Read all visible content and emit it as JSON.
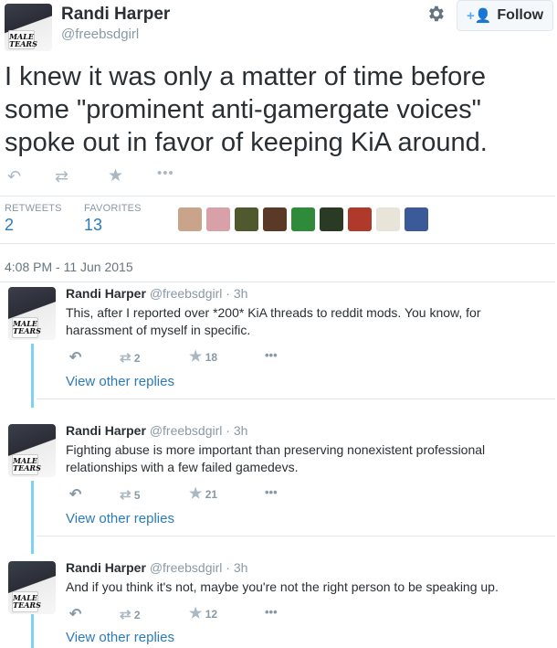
{
  "header": {
    "name": "Randi Harper",
    "handle": "@freebsdgirl",
    "follow_label": "Follow",
    "avatar_text": "MALE TEARS"
  },
  "tweet": {
    "text_lines": [
      "I knew it was only a matter of time before",
      "some \"prominent anti-gamergate voices\"",
      "spoke out in favor of keeping KiA around."
    ],
    "stats": {
      "retweets_label": "RETWEETS",
      "retweets_value": "2",
      "favorites_label": "FAVORITES",
      "favorites_value": "13"
    },
    "timestamp": "4:08 PM - 11 Jun 2015"
  },
  "favoriters": [
    {
      "color": "#c9a38a"
    },
    {
      "color": "#d8a0a8"
    },
    {
      "color": "#4e5a2e"
    },
    {
      "color": "#5a3a26"
    },
    {
      "color": "#2f8a3a"
    },
    {
      "color": "#2a3a24"
    },
    {
      "color": "#b03a2a"
    },
    {
      "color": "#e8e4da"
    },
    {
      "color": "#3a5a9a"
    }
  ],
  "replies": [
    {
      "name": "Randi Harper",
      "handle": "@freebsdgirl",
      "time": "· 3h",
      "lines": [
        "This, after I reported over *200* KiA threads to reddit mods. You know, for",
        "harassment of myself in specific."
      ],
      "retweets": "2",
      "favorites": "18",
      "view_other": "View other replies"
    },
    {
      "name": "Randi Harper",
      "handle": "@freebsdgirl",
      "time": "· 3h",
      "lines": [
        "Fighting abuse is more important than preserving nonexistent professional",
        "relationships with a few failed gamedevs."
      ],
      "retweets": "5",
      "favorites": "21",
      "view_other": "View other replies"
    },
    {
      "name": "Randi Harper",
      "handle": "@freebsdgirl",
      "time": "· 3h",
      "lines": [
        "And if you think it's not, maybe you're not the right person to be speaking up."
      ],
      "retweets": "2",
      "favorites": "12",
      "view_other": "View other replies"
    }
  ]
}
